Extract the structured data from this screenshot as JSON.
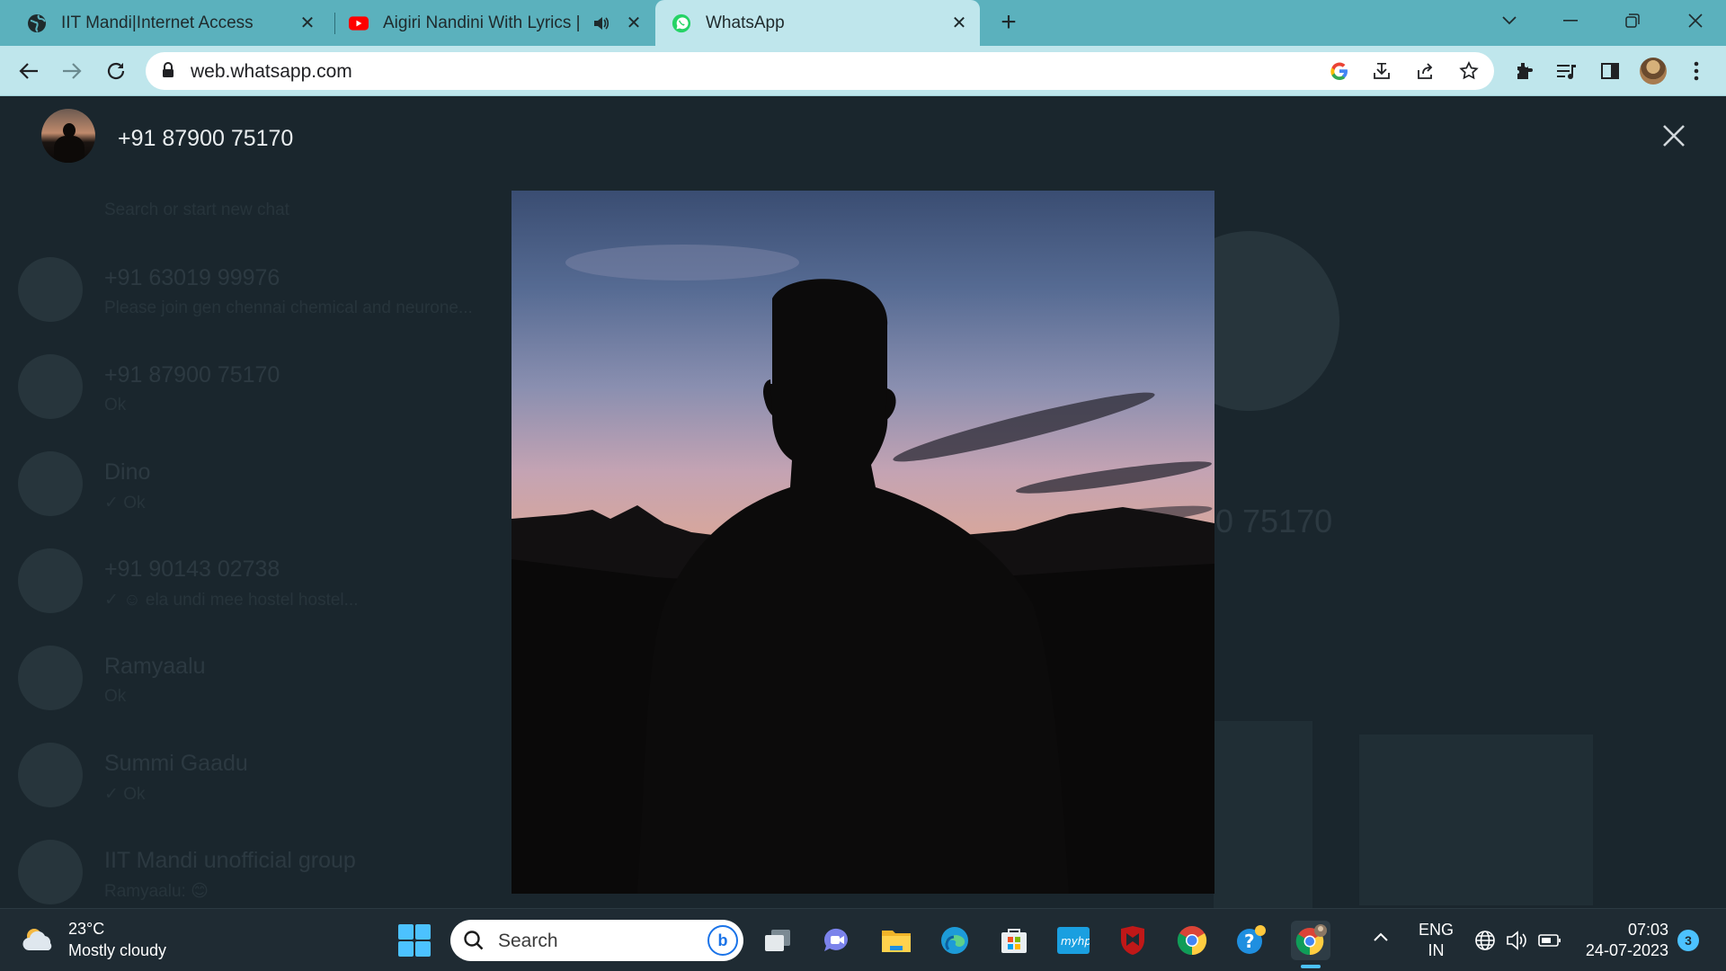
{
  "browser": {
    "tabs": [
      {
        "title": "IIT Mandi|Internet Access",
        "icon": "globe-icon",
        "active": false
      },
      {
        "title": "Aigiri Nandini With Lyrics | M",
        "icon": "youtube-icon",
        "audio_icon": "speaker-icon",
        "active": false
      },
      {
        "title": "WhatsApp",
        "icon": "whatsapp-icon",
        "active": true
      }
    ],
    "url": "web.whatsapp.com",
    "colors": {
      "tab_strip": "#5bb1bd",
      "toolbar": "#bfe6ec"
    }
  },
  "viewer": {
    "contact_name": "+91 87900 75170",
    "colors": {
      "text": "#e9edef",
      "backdrop": "#0b141a"
    }
  },
  "background_chats": {
    "search_placeholder": "Search or start new chat",
    "items": [
      {
        "name": "+91 63019 99976",
        "preview": "Please join gen chennai chemical and neurone..."
      },
      {
        "name": "+91 87900 75170",
        "preview": "Ok"
      },
      {
        "name": "Dino",
        "preview": "✓ Ok"
      },
      {
        "name": "+91 90143 02738",
        "preview": "✓ ☺ ela undi mee hostel hostel..."
      },
      {
        "name": "Ramyaalu",
        "preview": "Ok"
      },
      {
        "name": "Summi Gaadu",
        "preview": "✓ Ok"
      },
      {
        "name": "IIT Mandi unofficial group",
        "preview": "Ramyaalu: 😊"
      }
    ],
    "right_panel_number": "0 75170"
  },
  "taskbar": {
    "weather_temp": "23°C",
    "weather_desc": "Mostly cloudy",
    "search_label": "Search",
    "lang_line1": "ENG",
    "lang_line2": "IN",
    "time": "07:03",
    "date": "24-07-2023",
    "notification_count": "3",
    "accent": "#4cc2ff"
  }
}
